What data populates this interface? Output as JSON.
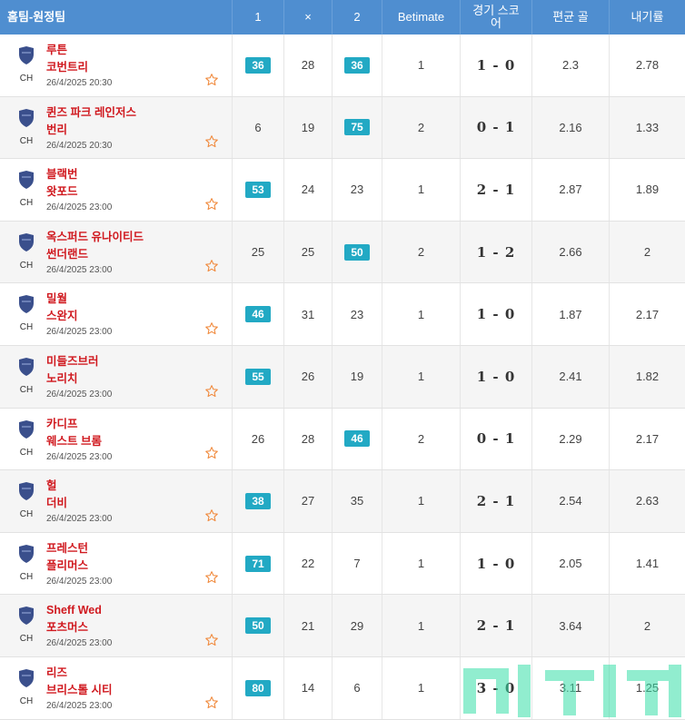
{
  "header": {
    "team_col": "홈팀-원정팀",
    "col_1": "1",
    "col_x": "×",
    "col_2": "2",
    "col_betimate": "Betimate",
    "col_score": "경기 스코어",
    "col_avg": "편균 골",
    "col_odds": "내기률"
  },
  "colors": {
    "header_bg": "#4f8ed0",
    "badge": "#22a9c4",
    "team_red": "#d0191f"
  },
  "matches": [
    {
      "league": "CH",
      "home": "루튼",
      "away": "코번트리",
      "date": "26/4/2025 20:30",
      "p1": "36",
      "px": "28",
      "p2": "36",
      "hl": [
        true,
        false,
        true
      ],
      "pick": "1",
      "score": "1 - 0",
      "avg": "2.3",
      "odds": "2.78"
    },
    {
      "league": "CH",
      "home": "퀸즈 파크 레인저스",
      "away": "번리",
      "date": "26/4/2025 20:30",
      "p1": "6",
      "px": "19",
      "p2": "75",
      "hl": [
        false,
        false,
        true
      ],
      "pick": "2",
      "score": "0 - 1",
      "avg": "2.16",
      "odds": "1.33"
    },
    {
      "league": "CH",
      "home": "블랙번",
      "away": "왓포드",
      "date": "26/4/2025 23:00",
      "p1": "53",
      "px": "24",
      "p2": "23",
      "hl": [
        true,
        false,
        false
      ],
      "pick": "1",
      "score": "2 - 1",
      "avg": "2.87",
      "odds": "1.89"
    },
    {
      "league": "CH",
      "home": "옥스퍼드 유나이티드",
      "away": "썬더랜드",
      "date": "26/4/2025 23:00",
      "p1": "25",
      "px": "25",
      "p2": "50",
      "hl": [
        false,
        false,
        true
      ],
      "pick": "2",
      "score": "1 - 2",
      "avg": "2.66",
      "odds": "2"
    },
    {
      "league": "CH",
      "home": "밀월",
      "away": "스완지",
      "date": "26/4/2025 23:00",
      "p1": "46",
      "px": "31",
      "p2": "23",
      "hl": [
        true,
        false,
        false
      ],
      "pick": "1",
      "score": "1 - 0",
      "avg": "1.87",
      "odds": "2.17"
    },
    {
      "league": "CH",
      "home": "미들즈브러",
      "away": "노리치",
      "date": "26/4/2025 23:00",
      "p1": "55",
      "px": "26",
      "p2": "19",
      "hl": [
        true,
        false,
        false
      ],
      "pick": "1",
      "score": "1 - 0",
      "avg": "2.41",
      "odds": "1.82"
    },
    {
      "league": "CH",
      "home": "카디프",
      "away": "웨스트 브롬",
      "date": "26/4/2025 23:00",
      "p1": "26",
      "px": "28",
      "p2": "46",
      "hl": [
        false,
        false,
        true
      ],
      "pick": "2",
      "score": "0 - 1",
      "avg": "2.29",
      "odds": "2.17"
    },
    {
      "league": "CH",
      "home": "헐",
      "away": "더비",
      "date": "26/4/2025 23:00",
      "p1": "38",
      "px": "27",
      "p2": "35",
      "hl": [
        true,
        false,
        false
      ],
      "pick": "1",
      "score": "2 - 1",
      "avg": "2.54",
      "odds": "2.63"
    },
    {
      "league": "CH",
      "home": "프레스턴",
      "away": "플리머스",
      "date": "26/4/2025 23:00",
      "p1": "71",
      "px": "22",
      "p2": "7",
      "hl": [
        true,
        false,
        false
      ],
      "pick": "1",
      "score": "1 - 0",
      "avg": "2.05",
      "odds": "1.41"
    },
    {
      "league": "CH",
      "home": "Sheff Wed",
      "away": "포츠머스",
      "date": "26/4/2025 23:00",
      "p1": "50",
      "px": "21",
      "p2": "29",
      "hl": [
        true,
        false,
        false
      ],
      "pick": "1",
      "score": "2 - 1",
      "avg": "3.64",
      "odds": "2"
    },
    {
      "league": "CH",
      "home": "리즈",
      "away": "브리스톨 시티",
      "date": "26/4/2025 23:00",
      "p1": "80",
      "px": "14",
      "p2": "6",
      "hl": [
        true,
        false,
        false
      ],
      "pick": "1",
      "score": "3 - 0",
      "avg": "3.11",
      "odds": "1.25"
    }
  ]
}
